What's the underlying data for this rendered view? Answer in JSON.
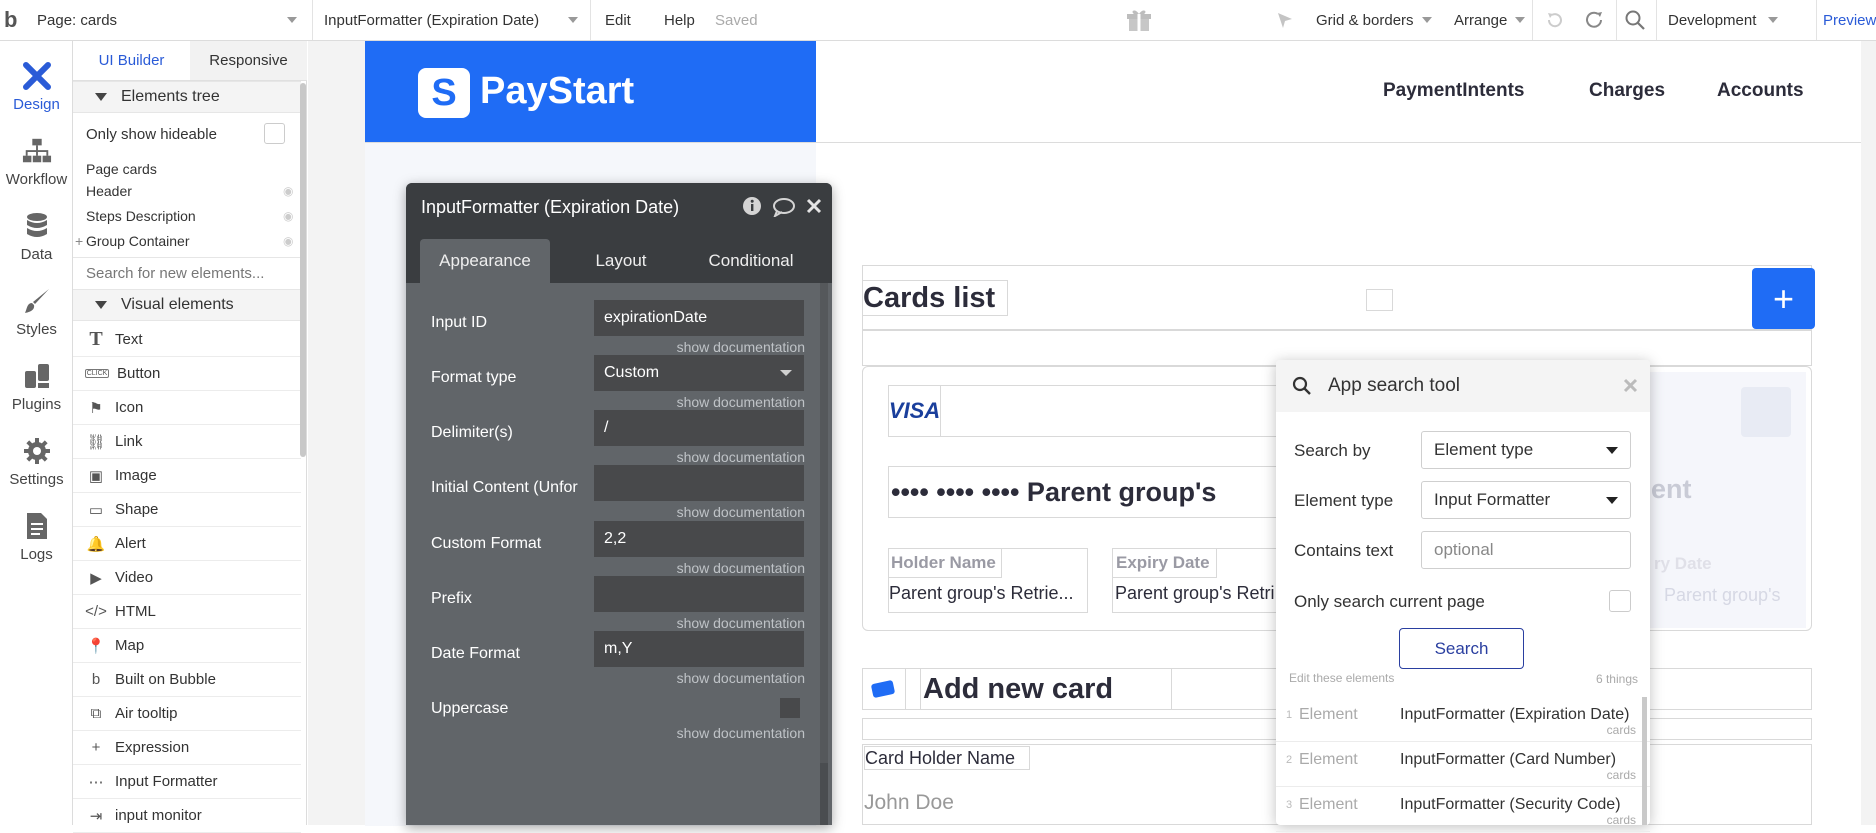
{
  "topbar": {
    "logo": "b",
    "page_label": "Page: cards",
    "element_selector": "InputFormatter (Expiration Date)",
    "menu_edit": "Edit",
    "menu_help": "Help",
    "status": "Saved",
    "grid_borders": "Grid & borders",
    "arrange": "Arrange",
    "environment": "Development",
    "preview": "Preview"
  },
  "leftnav": {
    "items": [
      {
        "label": "Design",
        "icon": "design-icon"
      },
      {
        "label": "Workflow",
        "icon": "workflow-icon"
      },
      {
        "label": "Data",
        "icon": "database-icon"
      },
      {
        "label": "Styles",
        "icon": "brush-icon"
      },
      {
        "label": "Plugins",
        "icon": "plugin-icon"
      },
      {
        "label": "Settings",
        "icon": "gear-icon"
      },
      {
        "label": "Logs",
        "icon": "document-icon"
      }
    ]
  },
  "panel": {
    "tab_ui_builder": "UI Builder",
    "tab_responsive": "Responsive",
    "elements_tree_title": "Elements tree",
    "only_show_hideable": "Only show hideable",
    "tree": [
      "Page cards",
      "Header",
      "Steps Description",
      "Group Container"
    ],
    "tree_search_placeholder": "Search for new elements...",
    "visual_elements_title": "Visual elements",
    "visual_elements": [
      {
        "label": "Text",
        "icon": "T"
      },
      {
        "label": "Button",
        "icon": "CLICK"
      },
      {
        "label": "Icon",
        "icon": "⚑"
      },
      {
        "label": "Link",
        "icon": "⛓"
      },
      {
        "label": "Image",
        "icon": "▣"
      },
      {
        "label": "Shape",
        "icon": "▭"
      },
      {
        "label": "Alert",
        "icon": "🔔"
      },
      {
        "label": "Video",
        "icon": "▶"
      },
      {
        "label": "HTML",
        "icon": "</>"
      },
      {
        "label": "Map",
        "icon": "📍"
      },
      {
        "label": "Built on Bubble",
        "icon": "b"
      },
      {
        "label": "Air tooltip",
        "icon": "⧉"
      },
      {
        "label": "Expression",
        "icon": "+"
      },
      {
        "label": "Input Formatter",
        "icon": "⋯"
      },
      {
        "label": "input monitor",
        "icon": "⇥"
      }
    ]
  },
  "app": {
    "logo_letter": "S",
    "logo_name": "PayStart",
    "nav": [
      "PaymentIntents",
      "Charges",
      "Accounts"
    ],
    "cards_list_title": "Cards list",
    "add_button": "+",
    "visa": "VISA",
    "card_number": "•••• •••• •••• Parent group's",
    "card_number_right": "ent",
    "holder_name_label": "Holder Name",
    "holder_name_value": "Parent group's Retrie...",
    "expiry_label": "Expiry Date",
    "expiry_value": "Parent group's Retri",
    "expiry_label_right": "ry Date",
    "expiry_value_right": "Parent group's",
    "add_new_card": "Add new card",
    "card_holder_name": "Card Holder Name",
    "john_doe": "John Doe"
  },
  "inspector": {
    "title": "InputFormatter (Expiration Date)",
    "tabs": [
      "Appearance",
      "Layout",
      "Conditional"
    ],
    "doc_link": "show documentation",
    "fields": [
      {
        "label": "Input ID",
        "value": "expirationDate"
      },
      {
        "label": "Format type",
        "value": "Custom"
      },
      {
        "label": "Delimiter(s)",
        "value": "/"
      },
      {
        "label": "Initial Content (Unfor",
        "value": ""
      },
      {
        "label": "Custom Format",
        "value": "2,2"
      },
      {
        "label": "Prefix",
        "value": ""
      },
      {
        "label": "Date Format",
        "value": "m,Y"
      },
      {
        "label": "Uppercase",
        "value": ""
      }
    ]
  },
  "search_tool": {
    "title": "App search tool",
    "search_by_label": "Search by",
    "search_by_value": "Element type",
    "element_type_label": "Element type",
    "element_type_value": "Input Formatter",
    "contains_text_label": "Contains text",
    "contains_text_placeholder": "optional",
    "only_current_page": "Only search current page",
    "search_button": "Search",
    "results_caption": "Edit these elements",
    "results_count": "6 things",
    "results": [
      {
        "index": "1",
        "kind": "Element",
        "name": "InputFormatter (Expiration Date)",
        "page": "cards"
      },
      {
        "index": "2",
        "kind": "Element",
        "name": "InputFormatter (Card Number)",
        "page": "cards"
      },
      {
        "index": "3",
        "kind": "Element",
        "name": "InputFormatter (Security Code)",
        "page": "cards"
      }
    ]
  },
  "colors": {
    "accent": "#2a5bd7",
    "brand": "#1f6cf5",
    "inspector_bg": "#616569"
  }
}
